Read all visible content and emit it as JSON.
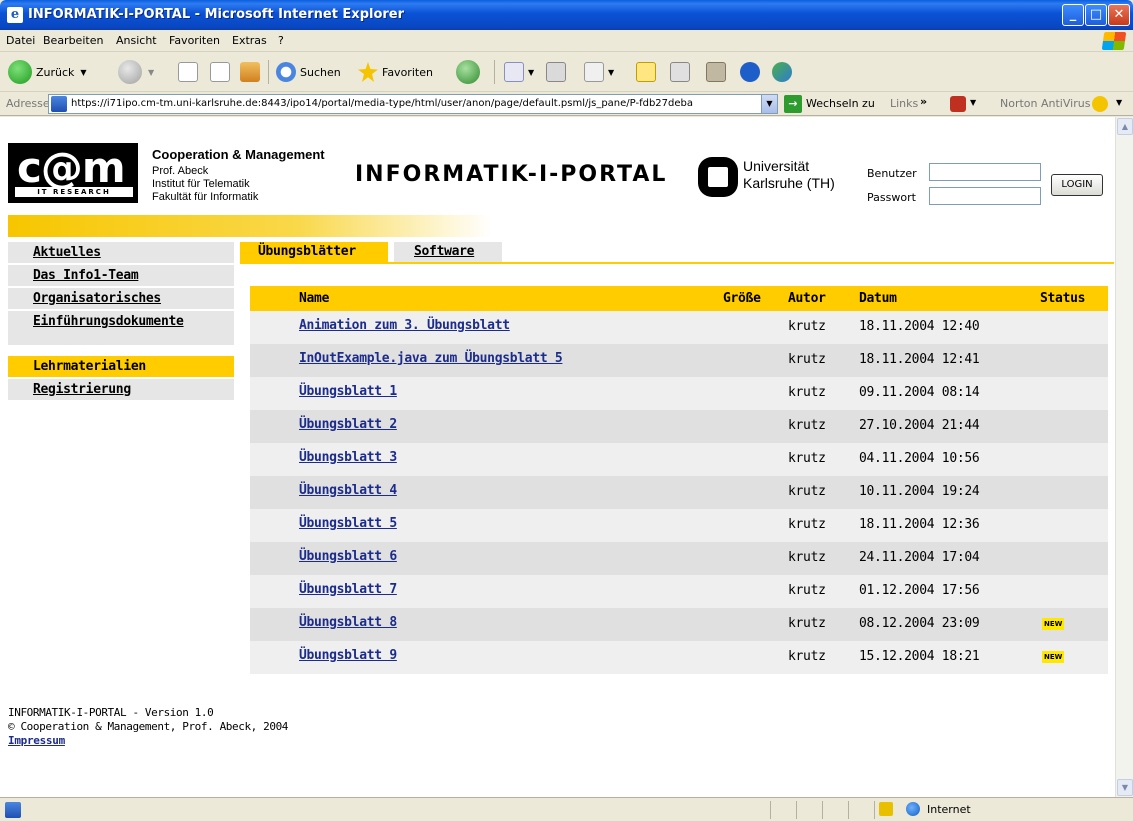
{
  "window": {
    "title": "INFORMATIK-I-PORTAL - Microsoft Internet Explorer",
    "min_glyph": "_",
    "max_glyph": "□",
    "close_glyph": "✕"
  },
  "menu": [
    "Datei",
    "Bearbeiten",
    "Ansicht",
    "Favoriten",
    "Extras",
    "?"
  ],
  "toolbar": {
    "back_label": "Zurück",
    "search_label": "Suchen",
    "favorites_label": "Favoriten"
  },
  "address": {
    "label": "Adresse",
    "url": "https://i71ipo.cm-tm.uni-karlsruhe.de:8443/ipo14/portal/media-type/html/user/anon/page/default.psml/js_pane/P-fdb27deba",
    "go_label": "Wechseln zu",
    "links_label": "Links",
    "norton_label": "Norton AntiVirus"
  },
  "header": {
    "logo_text": "c@m",
    "logo_sub": "IT RESEARCH",
    "coop_title": "Cooperation & Management",
    "coop_lines": [
      "Prof. Abeck",
      "Institut für Telematik",
      "Fakultät für Informatik"
    ],
    "portal_title": "INFORMATIK-I-PORTAL",
    "uni_lines": [
      "Universität",
      "Karlsruhe (TH)"
    ],
    "user_label": "Benutzer",
    "password_label": "Passwort",
    "login_label": "LOGIN"
  },
  "nav": {
    "items": [
      "Aktuelles",
      "Das Info1-Team",
      "Organisatorisches",
      "Einführungsdokumente",
      "Lehrmaterialien",
      "Registrierung"
    ],
    "active": "Lehrmaterialien"
  },
  "tabs": [
    "Übungsblätter",
    "Software"
  ],
  "table": {
    "headers": {
      "name": "Name",
      "size": "Größe",
      "author": "Autor",
      "date": "Datum",
      "status": "Status"
    },
    "rows": [
      {
        "name": "Animation zum 3. Übungsblatt",
        "author": "krutz",
        "date": "18.11.2004 12:40",
        "status": ""
      },
      {
        "name": "InOutExample.java zum Übungsblatt 5",
        "author": "krutz",
        "date": "18.11.2004 12:41",
        "status": ""
      },
      {
        "name": "Übungsblatt 1",
        "author": "krutz",
        "date": "09.11.2004 08:14",
        "status": ""
      },
      {
        "name": "Übungsblatt 2",
        "author": "krutz",
        "date": "27.10.2004 21:44",
        "status": ""
      },
      {
        "name": "Übungsblatt 3",
        "author": "krutz",
        "date": "04.11.2004 10:56",
        "status": ""
      },
      {
        "name": "Übungsblatt 4",
        "author": "krutz",
        "date": "10.11.2004 19:24",
        "status": ""
      },
      {
        "name": "Übungsblatt 5",
        "author": "krutz",
        "date": "18.11.2004 12:36",
        "status": ""
      },
      {
        "name": "Übungsblatt 6",
        "author": "krutz",
        "date": "24.11.2004 17:04",
        "status": ""
      },
      {
        "name": "Übungsblatt 7",
        "author": "krutz",
        "date": "01.12.2004 17:56",
        "status": ""
      },
      {
        "name": "Übungsblatt 8",
        "author": "krutz",
        "date": "08.12.2004 23:09",
        "status": "NEW"
      },
      {
        "name": "Übungsblatt 9",
        "author": "krutz",
        "date": "15.12.2004 18:21",
        "status": "NEW"
      }
    ]
  },
  "footer": {
    "version": "INFORMATIK-I-PORTAL - Version 1.0",
    "copyright": "© Cooperation & Management, Prof. Abeck, 2004",
    "impressum": "Impressum"
  },
  "statusbar": {
    "zone": "Internet"
  },
  "colors": {
    "accent": "#FFCC00",
    "link": "#1C2C8C",
    "row_light": "#EFEFEF",
    "row_dark": "#E0E0E0",
    "badge": "#FFE800"
  }
}
